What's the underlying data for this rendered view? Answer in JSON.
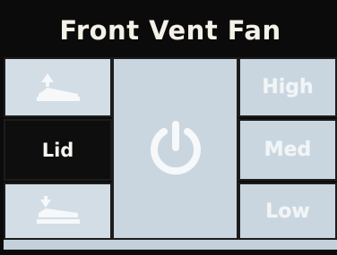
{
  "screen": {
    "title": "Front Vent Fan"
  },
  "lid_controls": {
    "open_icon": "lid-open-icon",
    "label": "Lid",
    "close_icon": "lid-close-icon"
  },
  "power": {
    "icon": "power-icon"
  },
  "speed_buttons": [
    {
      "label": "High"
    },
    {
      "label": "Med"
    },
    {
      "label": "Low"
    }
  ],
  "colors": {
    "tile": "#c9d6e0",
    "tile_text": "#f2f5f7",
    "dark": "#0e0e0e",
    "title_text": "#f4f2e8"
  }
}
